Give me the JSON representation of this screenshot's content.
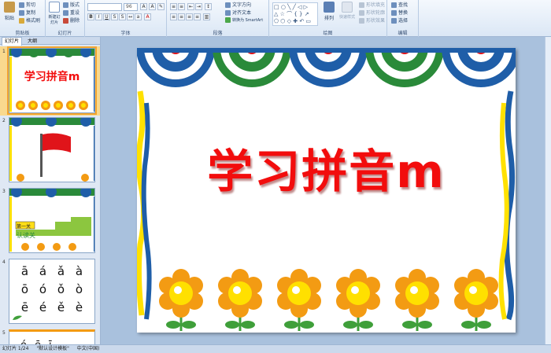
{
  "ribbon": {
    "clipboard": {
      "paste": "粘贴",
      "cut": "剪切",
      "copy": "复制",
      "format_painter": "格式刷",
      "group": "剪贴板"
    },
    "slides": {
      "new_slide": "新建幻灯片",
      "layout": "版式",
      "reset": "重设",
      "delete": "删除",
      "group": "幻灯片"
    },
    "font": {
      "font_name": "",
      "font_size": "96",
      "group": "字体"
    },
    "paragraph": {
      "text_direction": "文字方向",
      "align_text": "对齐文本",
      "smartart": "转换为 SmartArt",
      "group": "段落"
    },
    "drawing": {
      "arrange": "排列",
      "quick_styles": "快速样式",
      "shape_fill": "形状填充",
      "shape_outline": "形状轮廓",
      "shape_effects": "形状效果",
      "group": "绘图"
    },
    "editing": {
      "find": "查找",
      "replace": "替换",
      "select": "选择",
      "group": "编辑"
    }
  },
  "panel": {
    "tab_slides": "幻灯片",
    "tab_outline": "大纲"
  },
  "thumbnails": [
    {
      "num": "1",
      "title": "学习拼音m"
    },
    {
      "num": "2"
    },
    {
      "num": "3",
      "label1": "第一关",
      "label2": "认读关"
    },
    {
      "num": "4",
      "pinyin": [
        "ā",
        "á",
        "ǎ",
        "à",
        "ō",
        "ó",
        "ǒ",
        "ò",
        "ē",
        "é",
        "ě",
        "è"
      ]
    },
    {
      "num": "5",
      "pinyin": [
        "ó",
        "ē",
        "ī"
      ]
    }
  ],
  "slide": {
    "title": "学习拼音m"
  },
  "status": {
    "slide_pos": "幻灯片 1/24",
    "theme": "\"默认设计模板\"",
    "language": "中文(中国)"
  },
  "colors": {
    "title_red": "#f20d0d",
    "flower_orange": "#f39b13",
    "flower_yellow": "#ffe000",
    "leaf_green": "#3f9f3a",
    "stripe_blue": "#1f5ea8",
    "stripe_yellow": "#ffe100",
    "fan_green": "#2a8a3a"
  }
}
